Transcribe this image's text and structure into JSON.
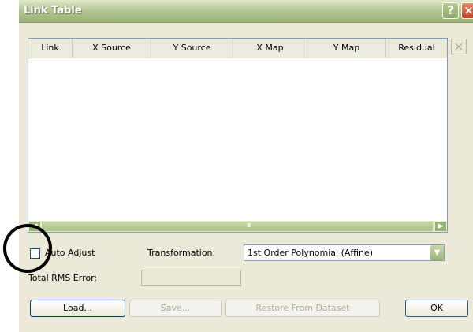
{
  "window": {
    "title": "Link Table",
    "help_glyph": "?",
    "close_glyph": "×"
  },
  "table": {
    "columns": [
      "Link",
      "X Source",
      "Y Source",
      "X Map",
      "Y Map",
      "Residual"
    ],
    "rows": []
  },
  "delete_glyph": "×",
  "scrollbar": {
    "left_glyph": "◀",
    "right_glyph": "▶",
    "grip": "IIII"
  },
  "auto_adjust": {
    "label": "Auto Adjust",
    "checked": false
  },
  "transformation": {
    "label": "Transformation:",
    "value": "1st Order Polynomial (Affine)",
    "arrow_glyph": "▼"
  },
  "rms": {
    "label": "Total RMS Error:",
    "value": ""
  },
  "buttons": {
    "load": "Load...",
    "save": "Save...",
    "restore": "Restore From Dataset",
    "ok": "OK"
  },
  "icons": {
    "help": "help-icon",
    "close": "close-icon",
    "delete": "delete-link-icon",
    "scroll_left": "arrow-left-icon",
    "scroll_right": "arrow-right-icon",
    "dropdown": "chevron-down-icon"
  },
  "colors": {
    "titlebar": "#b6c894",
    "dialog_bg": "#ece9d8",
    "annotation": "#000000"
  }
}
